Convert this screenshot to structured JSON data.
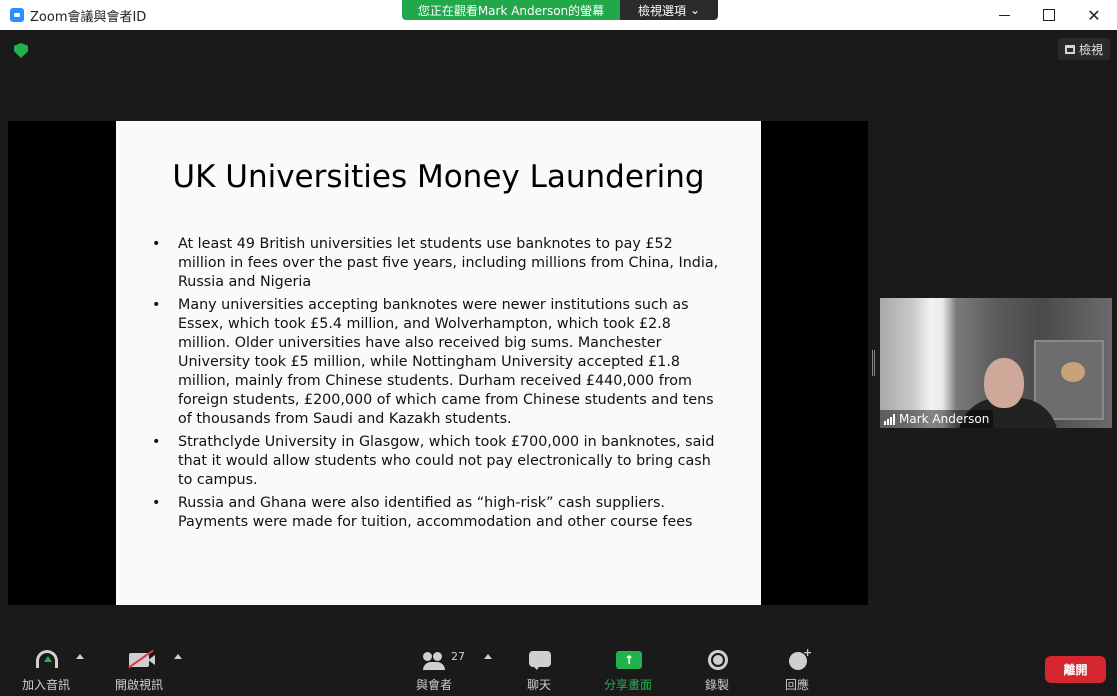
{
  "window": {
    "title": "Zoom會議與會者ID",
    "share_banner_text": "您正在觀看Mark  Anderson的螢幕",
    "view_options_label": "檢視選項",
    "view_options_caret": "⌄"
  },
  "meeting": {
    "view_button_label": "檢視",
    "presenter_name": "Mark Anderson"
  },
  "slide": {
    "title": "UK Universities Money Laundering",
    "bullets": [
      "At least 49 British universities let students use banknotes to pay £52 million in fees over the past five years, including millions from China, India, Russia and Nigeria",
      "Many universities accepting banknotes were newer institutions such as Essex, which took £5.4 million, and Wolverhampton, which took £2.8 million. Older universities have also received big sums. Manchester University took £5 million, while Nottingham University accepted £1.8 million, mainly from Chinese students. Durham received £440,000 from foreign students, £200,000 of which came from Chinese students and tens of thousands from Saudi and Kazakh students.",
      "Strathclyde University in Glasgow, which took £700,000 in banknotes, said that it would allow students who could not pay electronically to bring cash to campus.",
      "Russia and Ghana were also identified as “high-risk” cash suppliers. Payments were made for tuition, accommodation and other course fees"
    ]
  },
  "toolbar": {
    "join_audio_label": "加入音訊",
    "start_video_label": "開啟視訊",
    "participants_label": "與會者",
    "participants_count": "27",
    "chat_label": "聊天",
    "share_screen_label": "分享畫面",
    "record_label": "錄製",
    "reactions_label": "回應",
    "leave_label": "離開"
  },
  "colors": {
    "accent_green": "#23b14d",
    "leave_red": "#d6262f",
    "zoom_blue": "#2d8cff"
  }
}
